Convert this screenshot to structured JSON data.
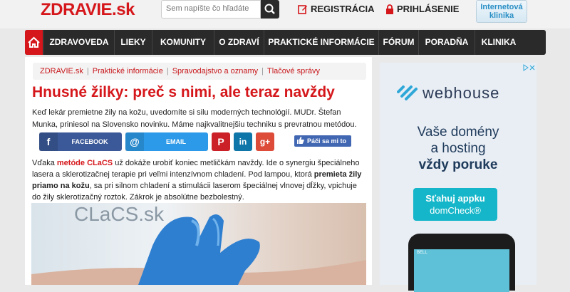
{
  "header": {
    "logo": "ZDRAVIE.sk",
    "search_placeholder": "Sem napíšte čo hľadáte",
    "register_label": "REGISTRÁCIA",
    "login_label": "PRIHLÁSENIE",
    "klinika_line1": "Internetová",
    "klinika_line2": "klinika"
  },
  "nav": {
    "items": [
      "ZDRAVOVEDA",
      "LIEKY",
      "KOMUNITY",
      "O ZDRAVÍ",
      "PRAKTICKÉ INFORMÁCIE",
      "FÓRUM",
      "PORADŇA",
      "KLINIKA"
    ]
  },
  "breadcrumb": [
    "ZDRAVIE.sk",
    "Praktické informácie",
    "Spravodajstvo a oznamy",
    "Tlačové správy"
  ],
  "article": {
    "title": "Hnusné žilky: preč s nimi, ale teraz navždy",
    "lead": "Keď lekár premietne žily na kožu, uvedomíte si silu moderných technológií. MUDr. Štefan Munka, priniesol na Slovensko novinku. Máme najkvalitnejšiu techniku s prevratnou metódou.",
    "body_1": "Vďaka ",
    "body_link": "metóde CLaCS",
    "body_2": " už dokáže urobiť koniec metličkám navždy. Ide o synergiu špeciálneho lasera a sklerotizačnej terapie pri veľmi intenzívnom chladení. Pod lampou, ktorá ",
    "body_bold": "premieta žily priamo na kožu",
    "body_3": ", sa pri silnom chladení a stimulácii laserom špeciálnej vlnovej dĺžky, vpichuje do žily sklerotizačný roztok. Zákrok je absolútne bezbolestný.",
    "photo_watermark": "CLaCS.sk"
  },
  "share": {
    "facebook": "FACEBOOK",
    "email": "EMAIL",
    "like": "Páči sa mi to 1",
    "colors": {
      "facebook": "#3b5998",
      "email": "#2c9ae8",
      "pinterest": "#cb2027",
      "linkedin": "#0e76a8",
      "google": "#dd4b39"
    }
  },
  "ad": {
    "brand": "webhouse",
    "line1": "Vaše domény",
    "line2": "a hosting",
    "line3": "vždy poruke",
    "button_line1": "Sťahuj appku",
    "button_line2": "domCheck®",
    "status": "BELL"
  },
  "colors": {
    "brand_red": "#d5171b",
    "nav_bg": "#2a2a2a"
  }
}
